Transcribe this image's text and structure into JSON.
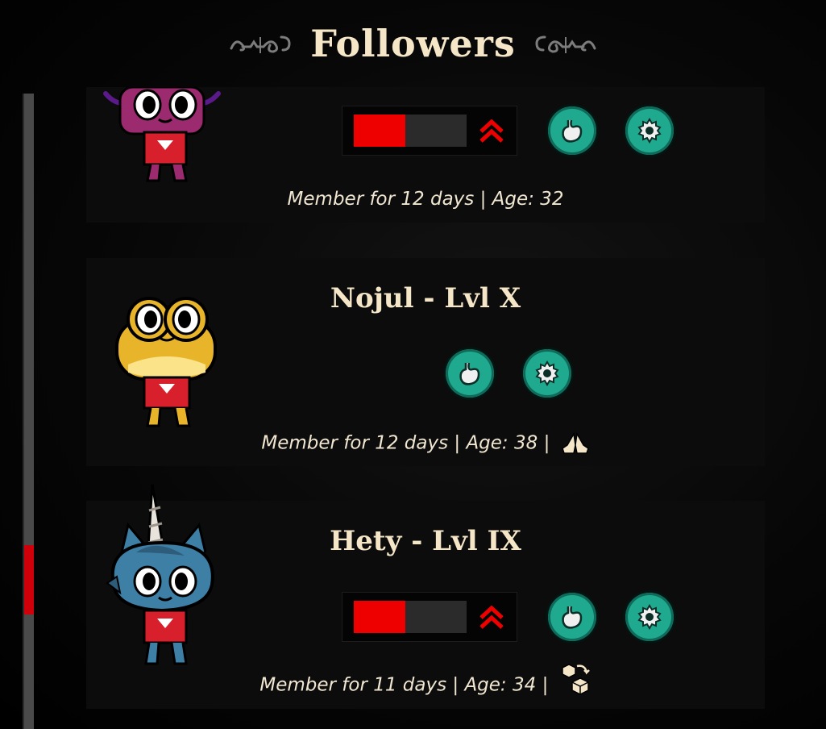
{
  "header": {
    "title": "Followers"
  },
  "followers": [
    {
      "name": "",
      "info": {
        "member": "Member for 12 days",
        "sep": "|",
        "age": "Age: 32"
      },
      "xp": {
        "fraction": 0.46,
        "levelup": true
      },
      "traits": [
        "stomach-icon",
        "gear-icon"
      ],
      "status_icon": null,
      "colors": {
        "body": "#9b2a6e",
        "accent": "#5a1a8a",
        "robe": "#d8202c"
      }
    },
    {
      "name": "Nojul - Lvl X",
      "info": {
        "member": "Member for 12 days",
        "sep": "|",
        "age": "Age: 38",
        "sep2": "|"
      },
      "xp": null,
      "traits": [
        "stomach-icon",
        "gear-icon"
      ],
      "status_icon": "praying-hands-icon",
      "colors": {
        "body": "#e8b52a",
        "accent": "#fbe38a",
        "robe": "#d8202c"
      }
    },
    {
      "name": "Hety - Lvl IX",
      "info": {
        "member": "Member for 11 days",
        "sep": "|",
        "age": "Age: 34",
        "sep2": "|"
      },
      "xp": {
        "fraction": 0.46,
        "levelup": true
      },
      "traits": [
        "stomach-icon",
        "gear-icon"
      ],
      "status_icon": "box-transfer-icon",
      "colors": {
        "body": "#3e7fa6",
        "accent": "#2d5d7a",
        "robe": "#d8202c"
      }
    }
  ],
  "colors": {
    "accent_red": "#ee0000",
    "trait_teal": "#1fa98f",
    "text_cream": "#f5e6c8"
  }
}
